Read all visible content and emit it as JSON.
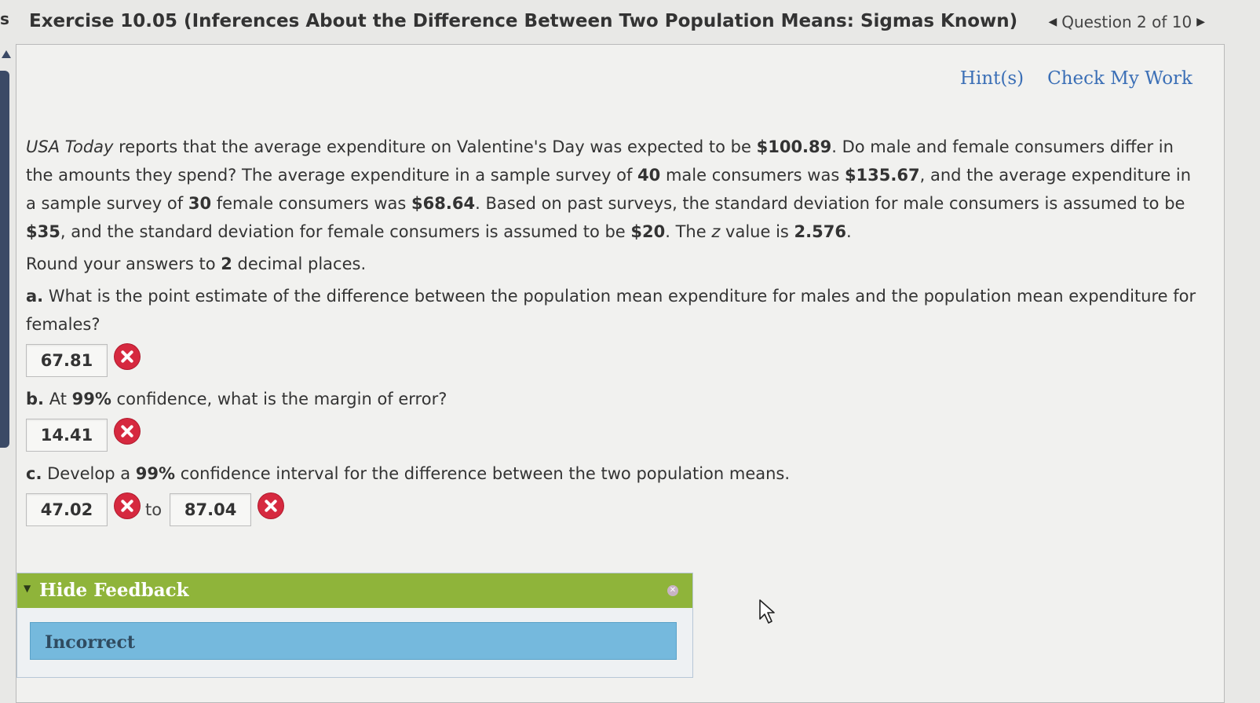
{
  "header": {
    "edge_char": "s",
    "title": "Exercise 10.05 (Inferences About the Difference Between Two Population Means: Sigmas Known)",
    "question_nav": "Question 2 of 10"
  },
  "links": {
    "hints": "Hint(s)",
    "check": "Check My Work"
  },
  "problem": {
    "source_italic": "USA Today",
    "text_1": " reports that the average expenditure on Valentine's Day was expected to be ",
    "v1": "$100.89",
    "text_2": ". Do male and female consumers differ in the amounts they spend? The average expenditure in a sample survey of ",
    "v2": "40",
    "text_3": " male consumers was ",
    "v3": "$135.67",
    "text_4": ", and the average expenditure in a sample survey of ",
    "v4": "30",
    "text_5": " female consumers was ",
    "v5": "$68.64",
    "text_6": ". Based on past surveys, the standard deviation for male consumers is assumed to be ",
    "v6": "$35",
    "text_7": ", and the standard deviation for female consumers is assumed to be ",
    "v7": "$20",
    "text_8": ". The ",
    "z_symbol": "z",
    "text_9": " value is ",
    "v8": "2.576",
    "text_10": "."
  },
  "instructions": {
    "prefix": "Round your answers to ",
    "num": "2",
    "suffix": " decimal places."
  },
  "question_a": {
    "label": "a.",
    "text": " What is the point estimate of the difference between the population mean expenditure for males and the population mean expenditure for females?",
    "answer": "67.81"
  },
  "question_b": {
    "label": "b.",
    "text_1": " At ",
    "pct": "99%",
    "text_2": " confidence, what is the margin of error?",
    "answer": "14.41"
  },
  "question_c": {
    "label": "c.",
    "text_1": " Develop a ",
    "pct": "99%",
    "text_2": " confidence interval for the difference between the two population means.",
    "answer_low": "47.02",
    "to": "to",
    "answer_high": "87.04"
  },
  "feedback": {
    "toggle_label": "Hide Feedback",
    "status": "Incorrect"
  },
  "colors": {
    "link": "#3b6fb6",
    "feedback_header": "#8fb43a",
    "feedback_body": "#75b9dd",
    "incorrect_icon": "#d6293f"
  }
}
